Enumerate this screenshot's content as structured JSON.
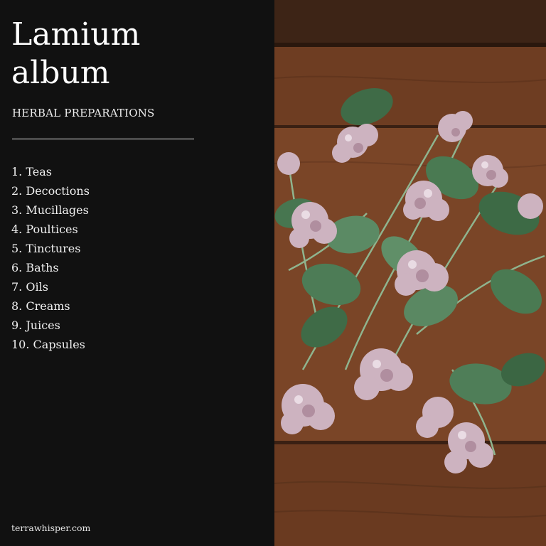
{
  "title": "Lamium album",
  "subtitle": "HERBAL PREPARATIONS",
  "preparations": [
    "1. Teas",
    "2. Decoctions",
    "3. Mucillages",
    "4. Poultices",
    "5. Tinctures",
    "6. Baths",
    "7. Oils",
    "8. Creams",
    "9. Juices",
    "10. Capsules"
  ],
  "footer": "terrawhisper.com",
  "colors": {
    "panel_background": "#111111",
    "text": "#ffffff",
    "wood": "#7a4527",
    "leaf": "#4f7a58",
    "flower": "#c9aebb"
  }
}
